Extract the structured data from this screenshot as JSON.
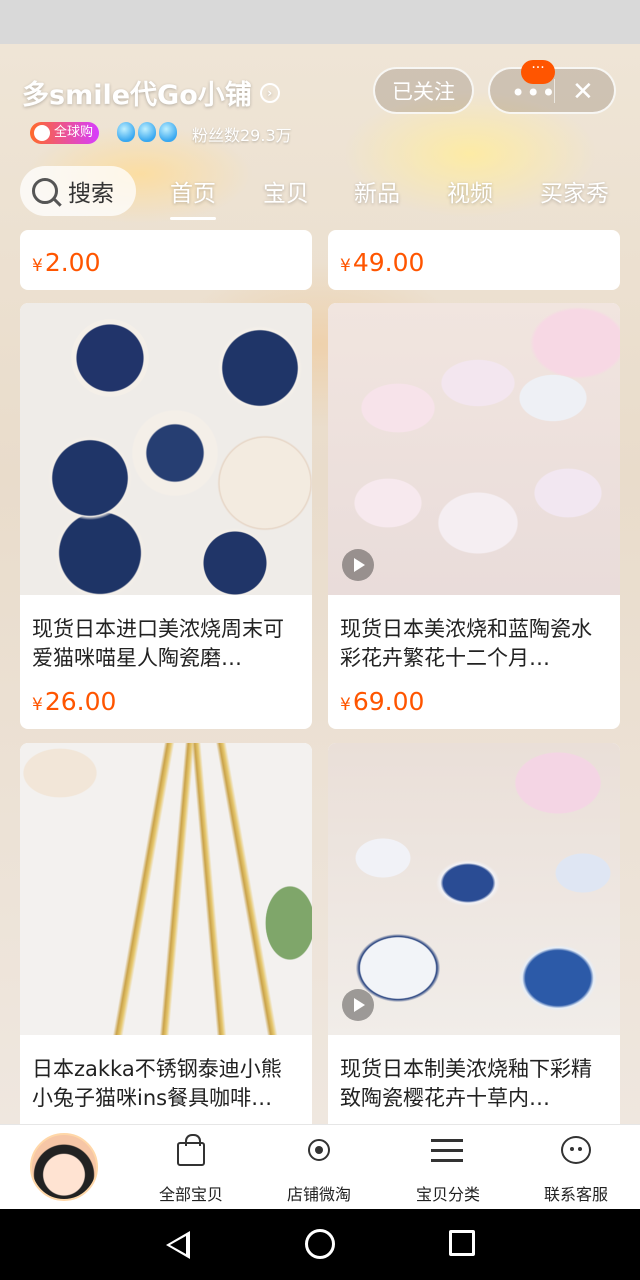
{
  "header": {
    "shop_name": "多smile代Go小铺",
    "follow_label": "已关注",
    "more_label": "•••",
    "badge_label": "···",
    "global_tag": "全球购",
    "fans": "粉丝数29.3万"
  },
  "tabs": {
    "search_label": "搜索",
    "items": [
      "首页",
      "宝贝",
      "新品",
      "视频",
      "买家秀"
    ]
  },
  "products": [
    {
      "price": "2.00"
    },
    {
      "price": "49.00"
    },
    {
      "title": "现货日本进口美浓烧周末可爱猫咪喵星人陶瓷磨…",
      "price": "26.00"
    },
    {
      "title": "现货日本美浓烧和蓝陶瓷水彩花卉繁花十二个月…",
      "price": "69.00"
    },
    {
      "title": "日本zakka不锈钢泰迪小熊小兔子猫咪ins餐具咖啡…"
    },
    {
      "title": "现货日本制美浓烧釉下彩精致陶瓷樱花卉十草内…"
    }
  ],
  "currency": "¥",
  "bottom_nav": {
    "items": [
      {
        "label": "全部宝贝"
      },
      {
        "label": "店铺微淘"
      },
      {
        "label": "宝贝分类"
      },
      {
        "label": "联系客服"
      }
    ]
  },
  "colors": {
    "price": "#ff5500",
    "badge": "#ff5500"
  }
}
